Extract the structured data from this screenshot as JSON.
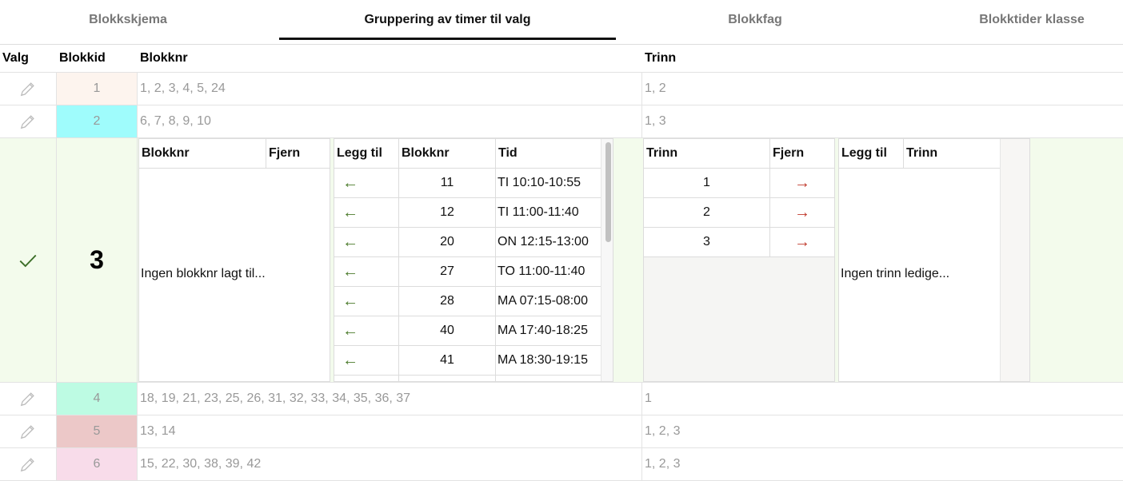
{
  "tabs": [
    {
      "label": "Blokkskjema",
      "active": false
    },
    {
      "label": "Gruppering av timer til valg",
      "active": true
    },
    {
      "label": "Blokkfag",
      "active": false
    },
    {
      "label": "Blokktider klasse",
      "active": false
    }
  ],
  "table": {
    "headers": {
      "valg": "Valg",
      "blokkid": "Blokkid",
      "blokknr": "Blokknr",
      "trinn": "Trinn"
    },
    "rows": [
      {
        "blokkid": "1",
        "blokknr": "1, 2, 3, 4, 5, 24",
        "trinn": "1, 2",
        "color": "#fdf4ee"
      },
      {
        "blokkid": "2",
        "blokknr": "6, 7, 8, 9, 10",
        "trinn": "1, 3",
        "color": "#9ffcfc"
      },
      {
        "blokkid": "4",
        "blokknr": "18, 19, 21, 23, 25, 26, 31, 32, 33, 34, 35, 36, 37",
        "trinn": "1",
        "color": "#bdfbe3"
      },
      {
        "blokkid": "5",
        "blokknr": "13, 14",
        "trinn": "1, 2, 3",
        "color": "#ecc8c8"
      },
      {
        "blokkid": "6",
        "blokknr": "15, 22, 30, 38, 39, 42",
        "trinn": "1, 2, 3",
        "color": "#f8dcea"
      }
    ]
  },
  "expanded": {
    "blokkid": "3",
    "selected_blokknr": {
      "headers": {
        "blokknr": "Blokknr",
        "fjern": "Fjern"
      },
      "empty_text": "Ingen blokknr lagt til..."
    },
    "available_blokknr": {
      "headers": {
        "legg_til": "Legg til",
        "blokknr": "Blokknr",
        "tid": "Tid"
      },
      "rows": [
        {
          "blokknr": "11",
          "tid": "TI 10:10-10:55"
        },
        {
          "blokknr": "12",
          "tid": "TI 11:00-11:40"
        },
        {
          "blokknr": "20",
          "tid": "ON 12:15-13:00"
        },
        {
          "blokknr": "27",
          "tid": "TO 11:00-11:40"
        },
        {
          "blokknr": "28",
          "tid": "MA 07:15-08:00"
        },
        {
          "blokknr": "40",
          "tid": "MA 17:40-18:25"
        },
        {
          "blokknr": "41",
          "tid": "MA 18:30-19:15"
        }
      ]
    },
    "selected_trinn": {
      "headers": {
        "trinn": "Trinn",
        "fjern": "Fjern"
      },
      "rows": [
        {
          "trinn": "1"
        },
        {
          "trinn": "2"
        },
        {
          "trinn": "3"
        }
      ]
    },
    "available_trinn": {
      "headers": {
        "legg_til": "Legg til",
        "trinn": "Trinn"
      },
      "empty_text": "Ingen trinn ledige..."
    }
  },
  "icons": {
    "edit": "pencil-icon",
    "check": "checkmark-icon",
    "add": "arrow-left-icon",
    "remove": "arrow-right-icon"
  },
  "colors": {
    "expanded_bg": "#f3fbec",
    "add_arrow": "#4a7a2a",
    "remove_arrow": "#c0392b"
  }
}
